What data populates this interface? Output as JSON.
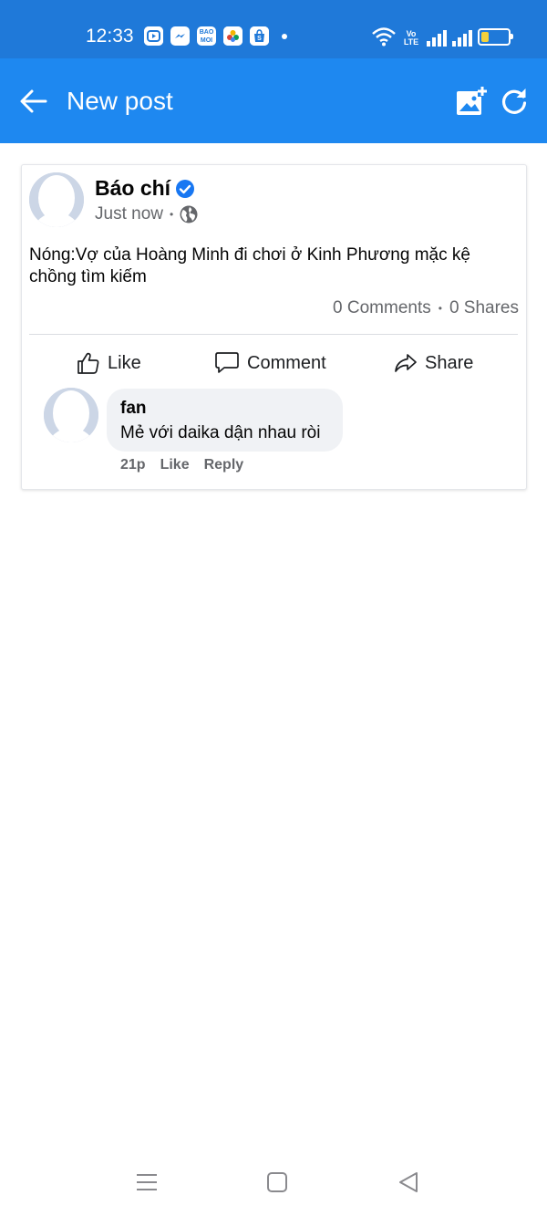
{
  "status_bar": {
    "time": "12:33",
    "apps": [
      "BAO MOI"
    ],
    "volte": "Vo LTE",
    "battery_level": 0.3,
    "battery_color": "#f3d13b"
  },
  "app_bar": {
    "title": "New post",
    "background": "#1e88f0"
  },
  "post": {
    "author": "Báo chí",
    "verified": true,
    "time": "Just now",
    "text": "Nóng:Vợ của Hoàng Minh đi chơi ở Kinh Phương mặc kệ chồng tìm kiếm",
    "comments_count": "0 Comments",
    "shares_count": "0 Shares",
    "actions": {
      "like": "Like",
      "comment": "Comment",
      "share": "Share"
    }
  },
  "comment": {
    "author": "fan",
    "text": "Mẻ với daika dận nhau ròi",
    "time": "21p",
    "like": "Like",
    "reply": "Reply"
  }
}
